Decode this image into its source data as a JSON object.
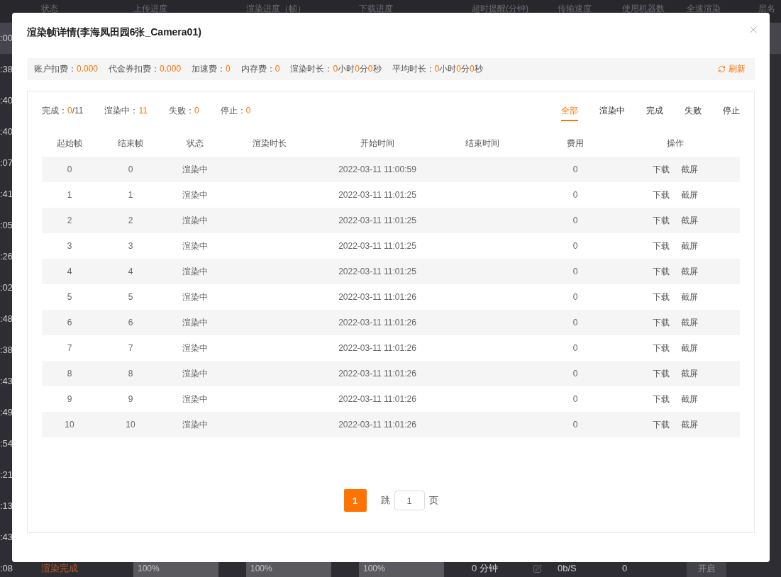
{
  "background_table": {
    "columns": [
      "状态",
      "上传进度",
      "渲染进度（帧）",
      "下载进度",
      "超时提醒(分钟)",
      "传输速度",
      "使用机器数",
      "全速渲染",
      "层名"
    ],
    "rows": [
      {
        "time": ":00",
        "selected": true
      },
      {
        "time": ":38",
        "selected": false
      },
      {
        "time": ":40",
        "selected": false
      },
      {
        "time": ":40",
        "selected": false
      },
      {
        "time": ":07",
        "selected": false
      },
      {
        "time": ":41",
        "selected": false
      },
      {
        "time": ":05",
        "selected": false
      },
      {
        "time": ":26",
        "selected": false
      },
      {
        "time": ":02",
        "selected": false
      },
      {
        "time": ":48",
        "selected": false
      },
      {
        "time": ":38",
        "selected": false
      },
      {
        "time": ":43",
        "selected": false
      },
      {
        "time": ":49",
        "selected": false
      },
      {
        "time": ":54",
        "selected": false
      },
      {
        "time": ":21",
        "selected": false
      },
      {
        "time": ":13",
        "selected": false
      },
      {
        "time": ":43",
        "selected": false
      },
      {
        "time": ":08",
        "selected": false,
        "status": "渲染完成",
        "upload": {
          "level": 1,
          "reading": "100%"
        },
        "render": {
          "level": 1,
          "reading": "100%"
        },
        "download": {
          "level": 1,
          "reading": "100%"
        },
        "timeout": "0 分钟",
        "speed": "0b/S",
        "machines": "0",
        "full_speed": "开启"
      }
    ]
  },
  "dialog": {
    "title": "渲染帧详情(李海凤田园6张_Camera01)",
    "stats": [
      {
        "kind": "amount",
        "label": "账户扣费：",
        "value": "0.000"
      },
      {
        "kind": "amount",
        "label": "代金券扣费：",
        "value": "0.000"
      },
      {
        "kind": "amount",
        "label": "加速费：",
        "value": "0"
      },
      {
        "kind": "amount",
        "label": "内存费：",
        "value": "0"
      },
      {
        "kind": "duration",
        "label": "渲染时长：",
        "parts": [
          {
            "value": "0",
            "unit": "小时"
          },
          {
            "value": "0",
            "unit": "分"
          },
          {
            "value": "0",
            "unit": "秒"
          }
        ]
      },
      {
        "kind": "duration",
        "label": "平均时长：",
        "parts": [
          {
            "value": "0",
            "unit": "小时"
          },
          {
            "value": "0",
            "unit": "分"
          },
          {
            "value": "0",
            "unit": "秒"
          }
        ]
      }
    ],
    "refresh": "刷新",
    "summary": [
      {
        "label": "完成：",
        "value": "0",
        "total": "/11"
      },
      {
        "label": "渲染中：",
        "value": "11"
      },
      {
        "label": "失败：",
        "value": "0"
      },
      {
        "label": "停止：",
        "value": "0"
      }
    ],
    "filters": [
      {
        "label": "全部",
        "selected": true
      },
      {
        "label": "渲染中",
        "selected": false
      },
      {
        "label": "完成",
        "selected": false
      },
      {
        "label": "失败",
        "selected": false
      },
      {
        "label": "停止",
        "selected": false
      }
    ],
    "table": {
      "columns": [
        "起始帧",
        "结束帧",
        "状态",
        "渲染时长",
        "开始时间",
        "结束时间",
        "费用",
        "操作"
      ],
      "rows": [
        {
          "start_frame": "0",
          "end_frame": "0",
          "status": "渲染中",
          "start_time": "2022-03-11 11:00:59",
          "cost": "0",
          "actions": [
            "下载",
            "截屏"
          ]
        },
        {
          "start_frame": "1",
          "end_frame": "1",
          "status": "渲染中",
          "start_time": "2022-03-11 11:01:25",
          "cost": "0",
          "actions": [
            "下载",
            "截屏"
          ]
        },
        {
          "start_frame": "2",
          "end_frame": "2",
          "status": "渲染中",
          "start_time": "2022-03-11 11:01:25",
          "cost": "0",
          "actions": [
            "下载",
            "截屏"
          ]
        },
        {
          "start_frame": "3",
          "end_frame": "3",
          "status": "渲染中",
          "start_time": "2022-03-11 11:01:25",
          "cost": "0",
          "actions": [
            "下载",
            "截屏"
          ]
        },
        {
          "start_frame": "4",
          "end_frame": "4",
          "status": "渲染中",
          "start_time": "2022-03-11 11:01:25",
          "cost": "0",
          "actions": [
            "下载",
            "截屏"
          ]
        },
        {
          "start_frame": "5",
          "end_frame": "5",
          "status": "渲染中",
          "start_time": "2022-03-11 11:01:26",
          "cost": "0",
          "actions": [
            "下载",
            "截屏"
          ]
        },
        {
          "start_frame": "6",
          "end_frame": "6",
          "status": "渲染中",
          "start_time": "2022-03-11 11:01:26",
          "cost": "0",
          "actions": [
            "下载",
            "截屏"
          ]
        },
        {
          "start_frame": "7",
          "end_frame": "7",
          "status": "渲染中",
          "start_time": "2022-03-11 11:01:26",
          "cost": "0",
          "actions": [
            "下载",
            "截屏"
          ]
        },
        {
          "start_frame": "8",
          "end_frame": "8",
          "status": "渲染中",
          "start_time": "2022-03-11 11:01:26",
          "cost": "0",
          "actions": [
            "下载",
            "截屏"
          ]
        },
        {
          "start_frame": "9",
          "end_frame": "9",
          "status": "渲染中",
          "start_time": "2022-03-11 11:01:26",
          "cost": "0",
          "actions": [
            "下载",
            "截屏"
          ]
        },
        {
          "start_frame": "10",
          "end_frame": "10",
          "status": "渲染中",
          "start_time": "2022-03-11 11:01:26",
          "cost": "0",
          "actions": [
            "下载",
            "截屏"
          ]
        }
      ]
    },
    "pagination": {
      "pages": [
        {
          "label": "1",
          "selected": true
        }
      ],
      "jump_label": "跳",
      "jump_value": "1",
      "suffix": "页"
    }
  }
}
